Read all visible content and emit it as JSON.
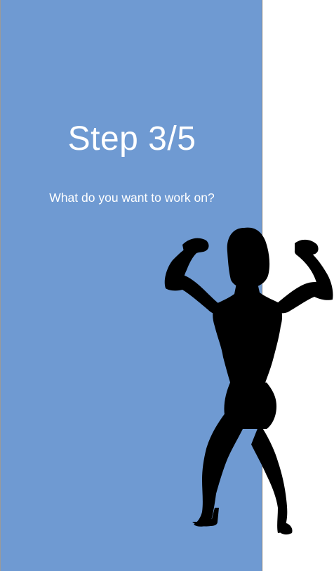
{
  "onboarding": {
    "step_label": "Step 3/5",
    "question": "What do you want to work on?",
    "illustration": "flexing-woman-silhouette-icon"
  },
  "colors": {
    "panel_background": "#6f9ad2",
    "text": "#ffffff",
    "silhouette": "#000000",
    "page_background": "#ffffff"
  }
}
